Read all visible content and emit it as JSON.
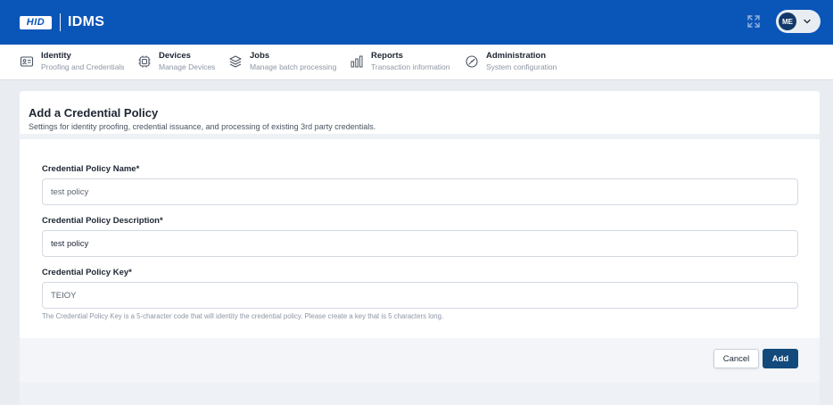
{
  "header": {
    "logo_text": "HID",
    "app_name": "IDMS",
    "user_initials": "ME"
  },
  "nav": {
    "items": [
      {
        "title": "Identity",
        "subtitle": "Proofing and Credentials",
        "icon": "id-card-icon"
      },
      {
        "title": "Devices",
        "subtitle": "Manage Devices",
        "icon": "chip-icon"
      },
      {
        "title": "Jobs",
        "subtitle": "Manage batch processing",
        "icon": "layers-icon"
      },
      {
        "title": "Reports",
        "subtitle": "Transaction information",
        "icon": "bar-chart-icon"
      },
      {
        "title": "Administration",
        "subtitle": "System configuration",
        "icon": "gauge-icon"
      }
    ]
  },
  "page": {
    "title": "Add a Credential Policy",
    "subtitle": "Settings for identity proofing, credential issuance, and processing of existing 3rd party credentials."
  },
  "form": {
    "name_label": "Credential Policy Name*",
    "name_value": "test policy",
    "description_label": "Credential Policy Description*",
    "description_value": "test policy",
    "key_label": "Credential Policy Key*",
    "key_value": "TEIOY",
    "key_help": "The Credential Policy Key is a 5-character code that will identity the credential policy. Please create a key that is 5 characters long."
  },
  "actions": {
    "cancel_label": "Cancel",
    "add_label": "Add"
  },
  "colors": {
    "header_bg": "#0a55b8",
    "primary_button": "#124a7c",
    "avatar_bg": "#13386a"
  }
}
